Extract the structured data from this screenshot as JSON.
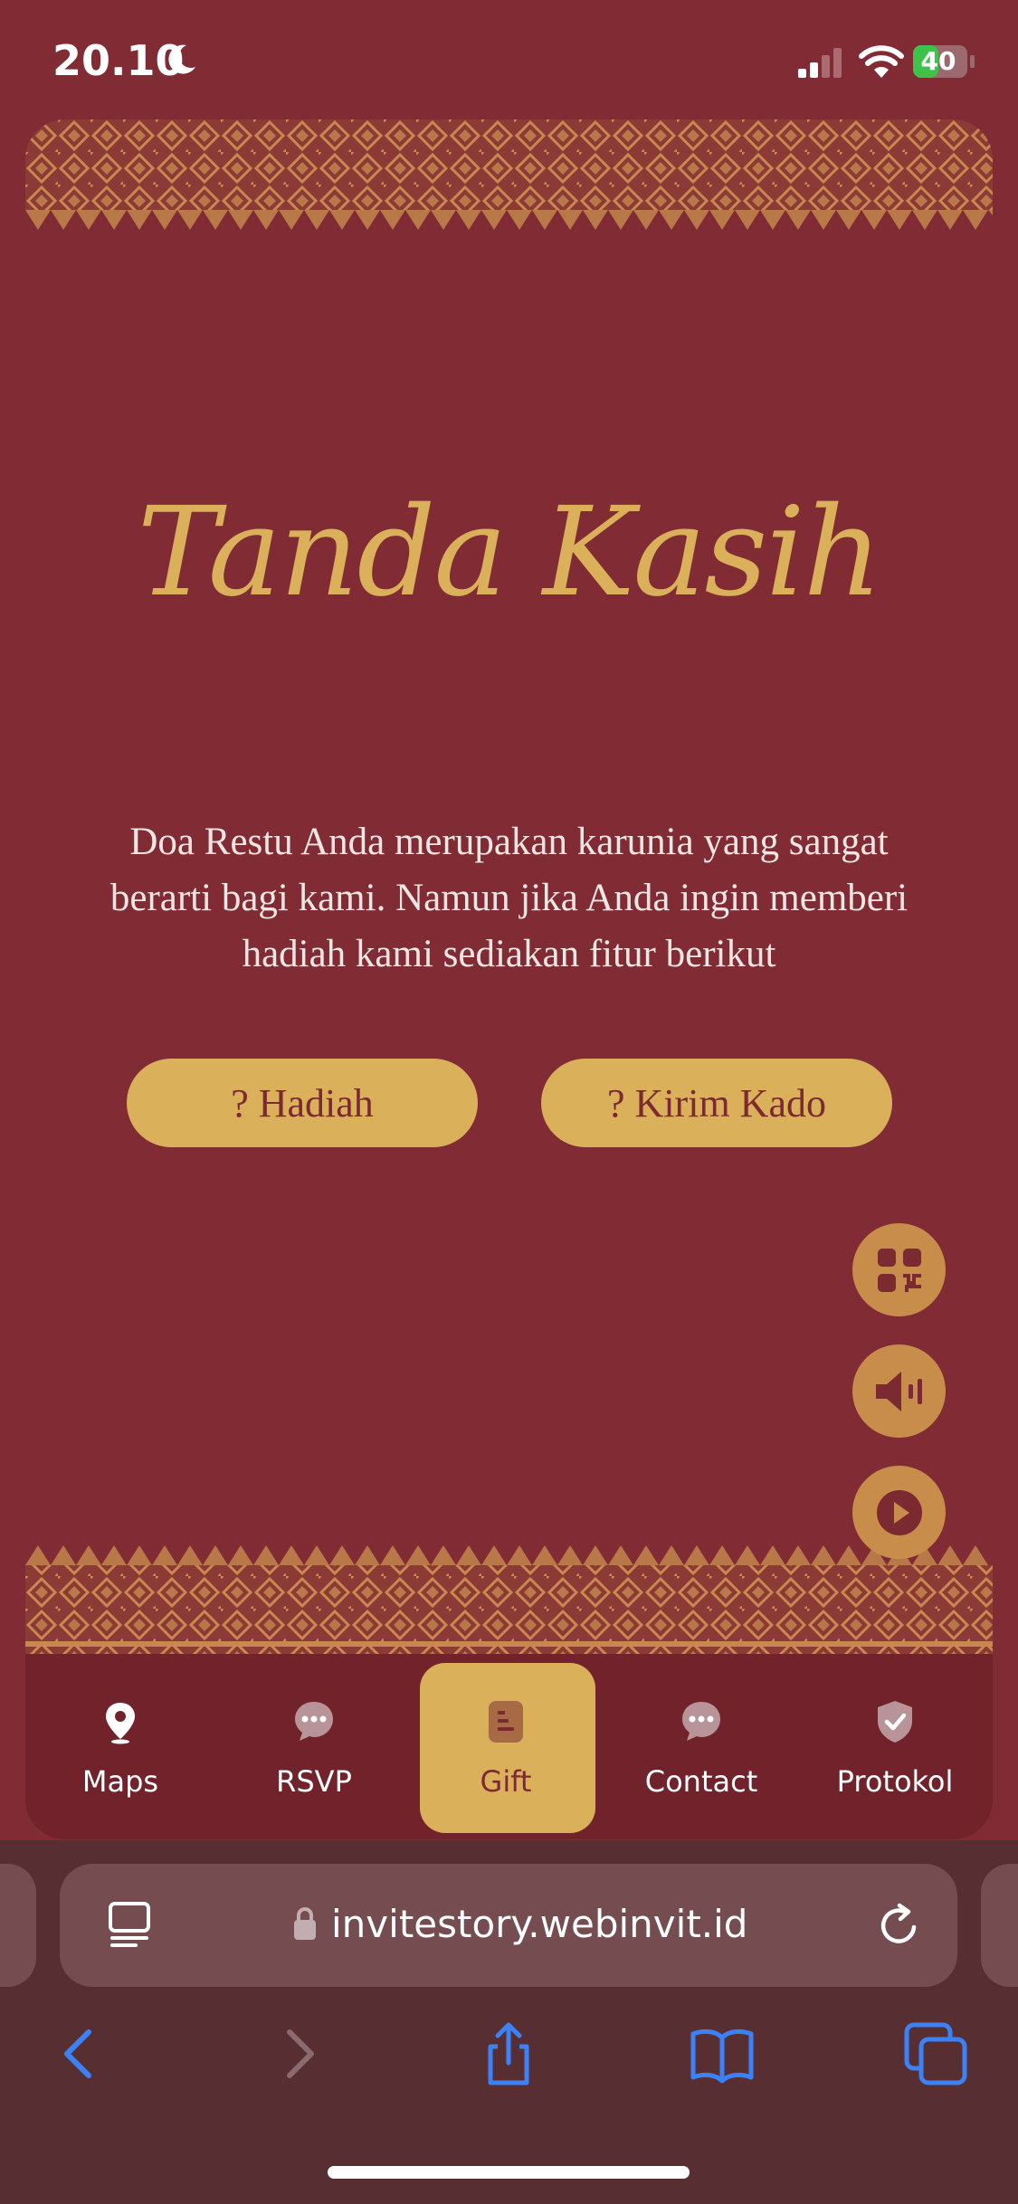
{
  "status_bar": {
    "time": "20.10",
    "battery": "40"
  },
  "section": {
    "title": "Tanda Kasih",
    "description": "Doa Restu Anda merupakan karunia yang sangat berarti bagi kami. Namun jika Anda ingin memberi hadiah kami sediakan fitur berikut"
  },
  "buttons": {
    "hadiah": "? Hadiah",
    "kado": "? Kirim Kado"
  },
  "floating": [
    "qr-code-icon",
    "speaker-icon",
    "play-icon"
  ],
  "nav": {
    "maps": "Maps",
    "rsvp": "RSVP",
    "gift": "Gift",
    "contact": "Contact",
    "protokol": "Protokol",
    "active": "Gift"
  },
  "browser": {
    "url": "invitestory.webinvit.id"
  },
  "colors": {
    "background": "#812c35",
    "accent": "#dab05b",
    "nav": "#71222b",
    "browser": "#572f33"
  }
}
